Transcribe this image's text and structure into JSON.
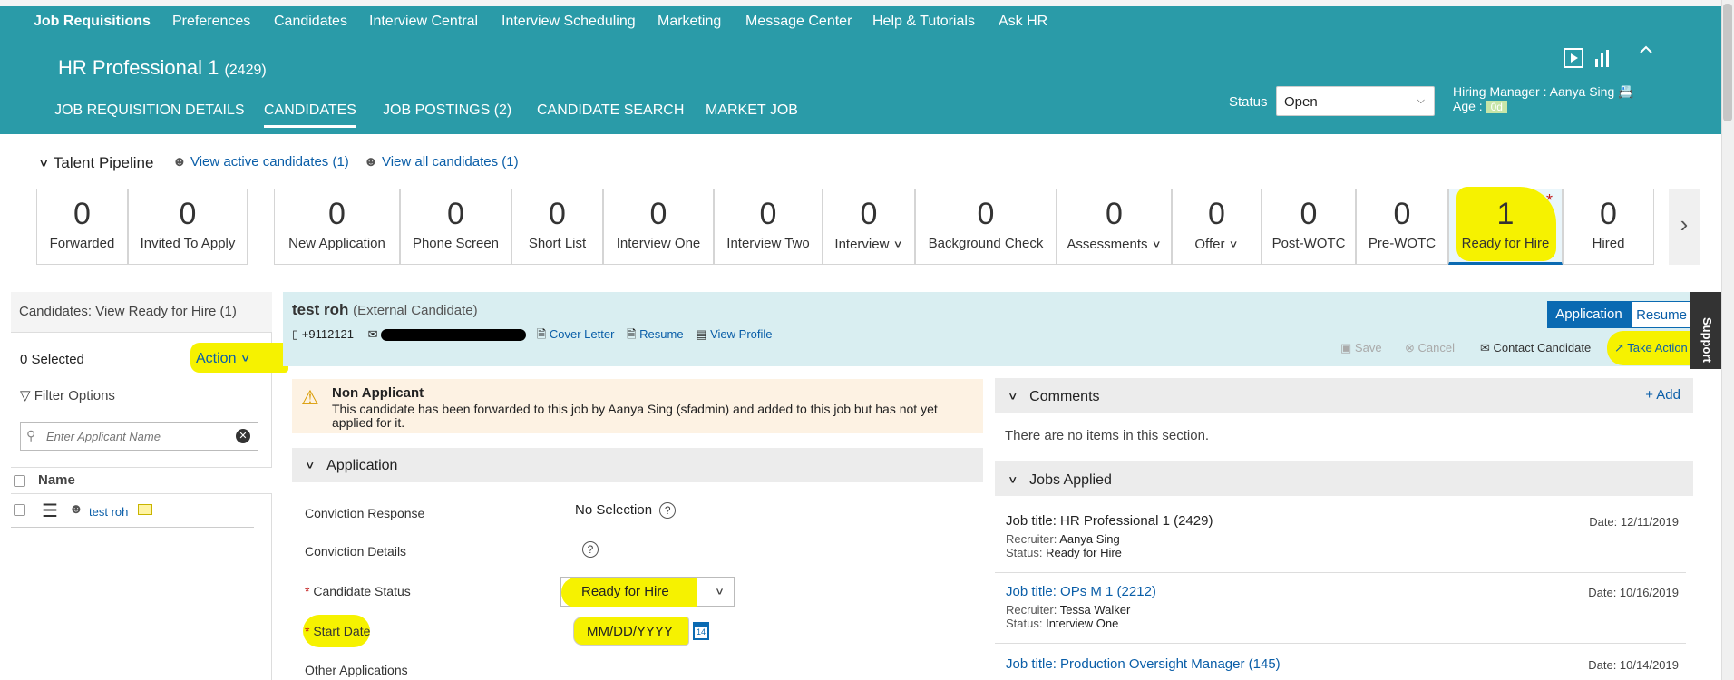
{
  "top_nav": [
    "Job Requisitions",
    "Preferences",
    "Candidates",
    "Interview Central",
    "Interview Scheduling",
    "Marketing",
    "Message Center",
    "Help & Tutorials",
    "Ask HR"
  ],
  "requisition": {
    "title": "HR Professional 1",
    "id": "(2429)"
  },
  "subtabs": [
    "JOB REQUISITION DETAILS",
    "CANDIDATES",
    "JOB POSTINGS (2)",
    "CANDIDATE SEARCH",
    "MARKET JOB"
  ],
  "status": {
    "label": "Status",
    "value": "Open"
  },
  "hiring_manager": {
    "label": "Hiring Manager :",
    "name": "Aanya Sing",
    "age_label": "Age :",
    "age_value": "0d"
  },
  "talent_pipeline": {
    "title": "Talent Pipeline",
    "view_active": "View active candidates (1)",
    "view_all": "View all candidates (1)",
    "stages": [
      {
        "count": "0",
        "label": "Forwarded"
      },
      {
        "count": "0",
        "label": "Invited To Apply"
      },
      {
        "count": "0",
        "label": "New Application"
      },
      {
        "count": "0",
        "label": "Phone Screen"
      },
      {
        "count": "0",
        "label": "Short List"
      },
      {
        "count": "0",
        "label": "Interview One"
      },
      {
        "count": "0",
        "label": "Interview Two"
      },
      {
        "count": "0",
        "label": "Interview"
      },
      {
        "count": "0",
        "label": "Background Check"
      },
      {
        "count": "0",
        "label": "Assessments"
      },
      {
        "count": "0",
        "label": "Offer"
      },
      {
        "count": "0",
        "label": "Post-WOTC"
      },
      {
        "count": "0",
        "label": "Pre-WOTC"
      },
      {
        "count": "1",
        "label": "Ready for Hire"
      },
      {
        "count": "0",
        "label": "Hired"
      }
    ]
  },
  "left_panel": {
    "header": "Candidates: View Ready for Hire (1)",
    "selected": "0 Selected",
    "action": "Action",
    "filter": "Filter Options",
    "search_placeholder": "Enter Applicant Name",
    "column_name": "Name",
    "candidates": [
      {
        "name": "test roh"
      }
    ]
  },
  "candidate": {
    "name": "test roh",
    "type": "(External Candidate)",
    "phone": "+9112121",
    "links": [
      "Cover Letter",
      "Resume",
      "View Profile"
    ],
    "tabs": [
      "Application",
      "Resume"
    ],
    "actions": [
      "Save",
      "Cancel",
      "Contact Candidate",
      "Take Action"
    ]
  },
  "notice": {
    "title": "Non Applicant",
    "text": "This candidate has been forwarded to this job by Aanya Sing (sfadmin) and added to this job but has not yet applied for it."
  },
  "application": {
    "section": "Application",
    "fields": [
      {
        "label": "Conviction Response",
        "value": "No Selection"
      },
      {
        "label": "Conviction Details",
        "value": ""
      },
      {
        "label": "Candidate Status",
        "value": "Ready for Hire"
      },
      {
        "label": "Start Date",
        "value": "MM/DD/YYYY"
      },
      {
        "label": "Other Applications",
        "value": ""
      }
    ]
  },
  "support": "Support",
  "comments": {
    "title": "Comments",
    "add": "+ Add",
    "empty": "There are no items in this section."
  },
  "jobs_applied": {
    "title": "Jobs Applied",
    "recruiter_label": "Recruiter:",
    "status_label": "Status:",
    "jobs": [
      {
        "title": "Job title: HR Professional 1 (2429)",
        "date": "Date: 12/11/2019",
        "recruiter": "Aanya Sing",
        "status": "Ready for Hire"
      },
      {
        "title": "Job title: OPs M 1 (2212)",
        "date": "Date: 10/16/2019",
        "recruiter": "Tessa Walker",
        "status": "Interview One"
      },
      {
        "title": "Job title: Production Oversight Manager (145)",
        "date": "Date: 10/14/2019",
        "recruiter": "",
        "status": ""
      }
    ]
  },
  "colors": {
    "teal": "#2a9ba8",
    "highlight": "#f6f200",
    "link": "#0a5ea8",
    "accent": "#0a6ab2"
  }
}
